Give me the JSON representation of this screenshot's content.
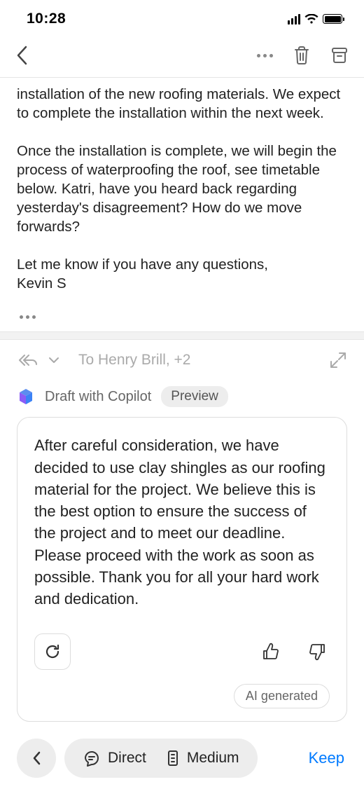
{
  "status": {
    "time": "10:28"
  },
  "email": {
    "paragraph1": "installation of the new roofing materials. We expect to complete the installation within the next week.",
    "paragraph2": "Once the installation is complete, we will begin the process of waterproofing the roof, see timetable below. Katri, have you heard back regarding yesterday's disagreement? How do we move forwards?",
    "paragraph3": "Let me know if you have any questions,",
    "signature": "Kevin S"
  },
  "reply": {
    "to_label": "To Henry Brill, +2"
  },
  "copilot": {
    "label": "Draft with Copilot",
    "badge": "Preview",
    "draft_text": "After careful consideration, we have decided to use clay shingles as our roofing material for the project. We believe this is the best option to ensure the success of the project and to meet our deadline. Please proceed with the work as soon as possible.  Thank you for all your hard work and dedication.",
    "ai_label": "AI generated"
  },
  "bottombar": {
    "direct": "Direct",
    "medium": "Medium",
    "keep": "Keep"
  }
}
